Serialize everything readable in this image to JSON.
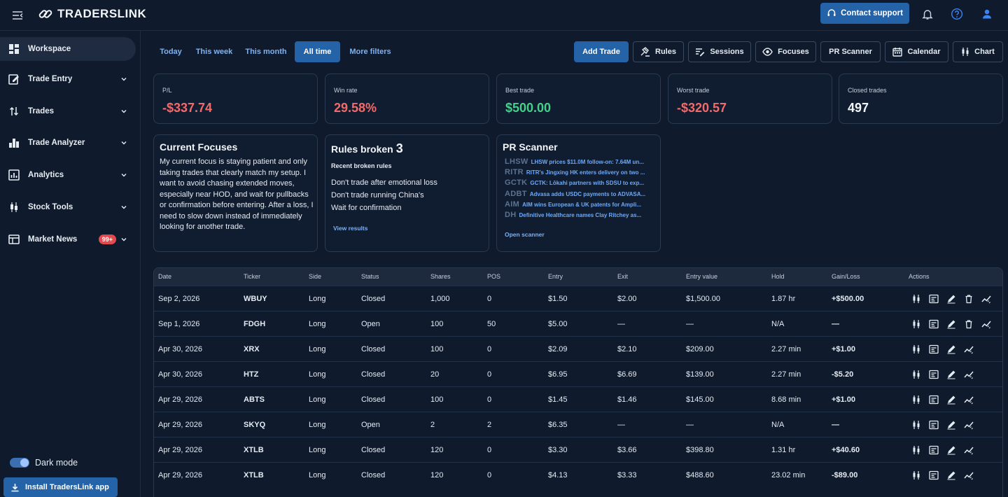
{
  "brand": {
    "name": "TRADERSLINK"
  },
  "header": {
    "support_label": "Contact support",
    "icons": [
      "bell-icon",
      "help-icon",
      "user-icon"
    ]
  },
  "sidebar": {
    "items": [
      {
        "label": "Workspace",
        "icon": "grid-icon",
        "active": true
      },
      {
        "label": "Trade Entry",
        "icon": "edit-icon"
      },
      {
        "label": "Trades",
        "icon": "sort-icon"
      },
      {
        "label": "Trade Analyzer",
        "icon": "bar-chart-icon"
      },
      {
        "label": "Analytics",
        "icon": "analytics-icon"
      },
      {
        "label": "Stock Tools",
        "icon": "candlestick-icon"
      },
      {
        "label": "Market News",
        "icon": "news-icon",
        "badge": "99+"
      }
    ],
    "dark_mode_label": "Dark mode",
    "install_label": "Install TradersLink app"
  },
  "filters": [
    "Today",
    "This week",
    "This month",
    "All time",
    "More filters"
  ],
  "active_filter": "All time",
  "toolbar": [
    "Add Trade",
    "Rules",
    "Sessions",
    "Focuses",
    "PR Scanner",
    "Calendar",
    "Chart"
  ],
  "stats": [
    {
      "label": "P/L",
      "value": "-$337.74",
      "tone": "neg"
    },
    {
      "label": "Win rate",
      "value": "29.58%",
      "tone": "neg"
    },
    {
      "label": "Best trade",
      "value": "$500.00",
      "tone": "pos"
    },
    {
      "label": "Worst trade",
      "value": "-$320.57",
      "tone": "neg"
    },
    {
      "label": "Closed trades",
      "value": "497",
      "tone": "neutral"
    }
  ],
  "focuses": {
    "title": "Current Focuses",
    "text": "My current focus is staying patient and only taking trades that clearly match my setup. I want to avoid chasing extended moves, especially near HOD, and wait for pullbacks or confirmation before entering. After a loss, I need to slow down instead of immediately looking for another trade."
  },
  "rules": {
    "title": "Rules broken",
    "count": "3",
    "subtitle": "Recent broken rules",
    "items": [
      "Don't trade after emotional loss",
      "Don't trade running China's",
      "Wait for confirmation"
    ],
    "link": "View results"
  },
  "scanner": {
    "title": "PR Scanner",
    "items": [
      {
        "ticker": "LHSW",
        "headline": "LHSW prices $11.0M follow-on: 7.64M un..."
      },
      {
        "ticker": "RITR",
        "headline": "RITR's Jingxing HK enters delivery on two ..."
      },
      {
        "ticker": "GCTK",
        "headline": "GCTK: Lōkahi partners with SDSU to exp..."
      },
      {
        "ticker": "ADBT",
        "headline": "Advasa adds USDC payments to ADVASA..."
      },
      {
        "ticker": "AIM",
        "headline": "AIM wins European & UK patents for Ampli..."
      },
      {
        "ticker": "DH",
        "headline": "Definitive Healthcare names Clay Ritchey as..."
      }
    ],
    "link": "Open scanner"
  },
  "table": {
    "columns": [
      "Date",
      "Ticker",
      "Side",
      "Status",
      "Shares",
      "POS",
      "Entry",
      "Exit",
      "Entry value",
      "Hold",
      "Gain/Loss",
      "Actions"
    ],
    "rows": [
      {
        "date": "Sep 2, 2026",
        "ticker": "WBUY",
        "side": "Long",
        "status": "Closed",
        "shares": "1,000",
        "pos": "0",
        "entry": "$1.50",
        "exit": "$2.00",
        "entry_value": "$1,500.00",
        "hold": "1.87 hr",
        "gain": "+$500.00",
        "delete": true
      },
      {
        "date": "Sep 1, 2026",
        "ticker": "FDGH",
        "side": "Long",
        "status": "Open",
        "shares": "100",
        "pos": "50",
        "entry": "$5.00",
        "exit": "—",
        "entry_value": "—",
        "hold": "N/A",
        "gain": "—",
        "delete": true
      },
      {
        "date": "Apr 30, 2026",
        "ticker": "XRX",
        "side": "Long",
        "status": "Closed",
        "shares": "100",
        "pos": "0",
        "entry": "$2.09",
        "exit": "$2.10",
        "entry_value": "$209.00",
        "hold": "2.27 min",
        "gain": "+$1.00",
        "delete": false
      },
      {
        "date": "Apr 30, 2026",
        "ticker": "HTZ",
        "side": "Long",
        "status": "Closed",
        "shares": "20",
        "pos": "0",
        "entry": "$6.95",
        "exit": "$6.69",
        "entry_value": "$139.00",
        "hold": "2.27 min",
        "gain": "-$5.20",
        "delete": false
      },
      {
        "date": "Apr 29, 2026",
        "ticker": "ABTS",
        "side": "Long",
        "status": "Closed",
        "shares": "100",
        "pos": "0",
        "entry": "$1.45",
        "exit": "$1.46",
        "entry_value": "$145.00",
        "hold": "8.68 min",
        "gain": "+$1.00",
        "delete": false
      },
      {
        "date": "Apr 29, 2026",
        "ticker": "SKYQ",
        "side": "Long",
        "status": "Open",
        "shares": "2",
        "pos": "2",
        "entry": "$6.35",
        "exit": "—",
        "entry_value": "—",
        "hold": "N/A",
        "gain": "—",
        "delete": false
      },
      {
        "date": "Apr 29, 2026",
        "ticker": "XTLB",
        "side": "Long",
        "status": "Closed",
        "shares": "120",
        "pos": "0",
        "entry": "$3.30",
        "exit": "$3.66",
        "entry_value": "$398.80",
        "hold": "1.31 hr",
        "gain": "+$40.60",
        "delete": false
      },
      {
        "date": "Apr 29, 2026",
        "ticker": "XTLB",
        "side": "Long",
        "status": "Closed",
        "shares": "120",
        "pos": "0",
        "entry": "$4.13",
        "exit": "$3.33",
        "entry_value": "$488.60",
        "hold": "23.02 min",
        "gain": "-$89.00",
        "delete": false
      }
    ]
  }
}
